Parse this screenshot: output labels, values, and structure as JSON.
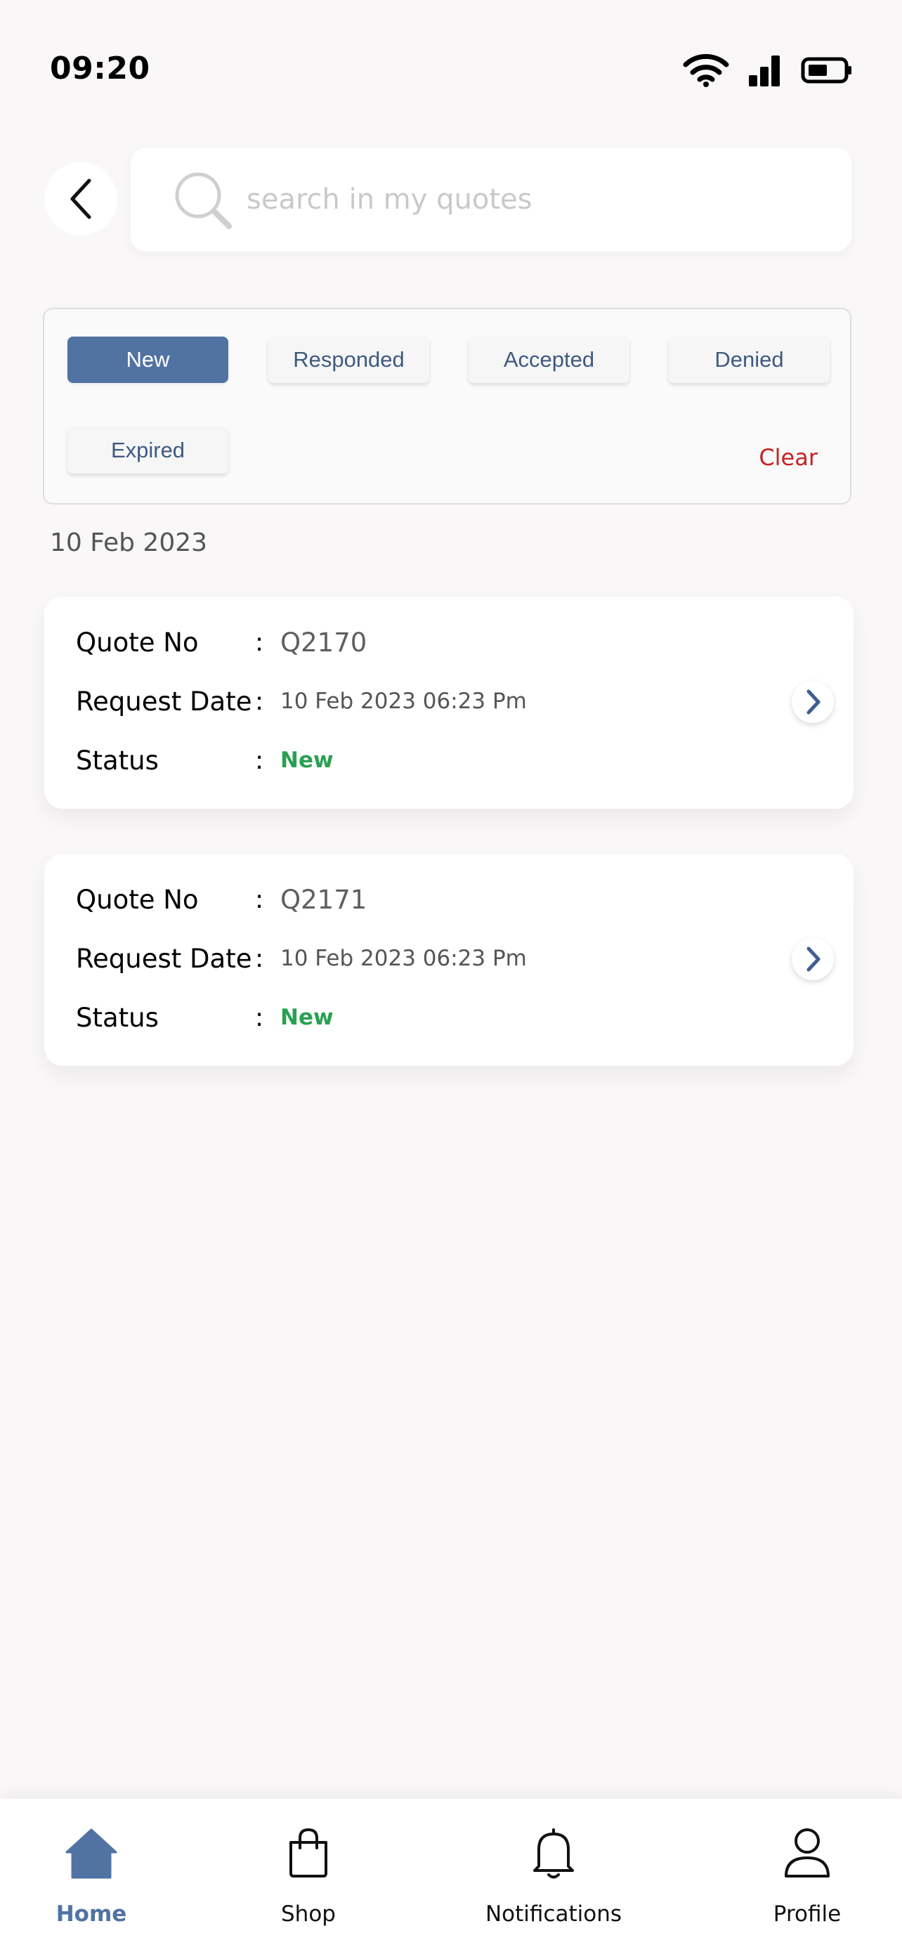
{
  "status_bar": {
    "time": "09:20",
    "icons": [
      "wifi-icon",
      "signal-icon",
      "battery-icon"
    ]
  },
  "header": {
    "back_icon": "chevron-left-icon",
    "search": {
      "placeholder": "search in my quotes",
      "value": "",
      "icon": "search-icon"
    }
  },
  "filters": {
    "chips": [
      {
        "label": "New",
        "active": true
      },
      {
        "label": "Responded",
        "active": false
      },
      {
        "label": "Accepted",
        "active": false
      },
      {
        "label": "Denied",
        "active": false
      },
      {
        "label": "Expired",
        "active": false
      }
    ],
    "clear_label": "Clear"
  },
  "date_group": "10 Feb 2023",
  "quotes": [
    {
      "quote_label": "Quote No",
      "quote_no": "Q2170",
      "date_label": "Request Date",
      "request_date": "10 Feb 2023 06:23 Pm",
      "status_label": "Status",
      "status": "New"
    },
    {
      "quote_label": "Quote No",
      "quote_no": "Q2171",
      "date_label": "Request Date",
      "request_date": "10 Feb 2023 06:23 Pm",
      "status_label": "Status",
      "status": "New"
    }
  ],
  "separator": ":",
  "bottom_nav": [
    {
      "label": "Home",
      "icon": "home-icon",
      "active": true
    },
    {
      "label": "Shop",
      "icon": "shopping-bag-icon",
      "active": false
    },
    {
      "label": "Notifications",
      "icon": "bell-icon",
      "active": false
    },
    {
      "label": "Profile",
      "icon": "user-icon",
      "active": false
    }
  ],
  "colors": {
    "accent": "#5173a3",
    "status_new": "#2aa152",
    "clear": "#c62222",
    "background": "#f9f7f8"
  }
}
